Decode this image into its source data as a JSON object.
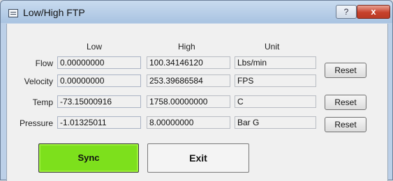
{
  "window": {
    "title": "Low/High FTP",
    "help_glyph": "?",
    "close_glyph": "x"
  },
  "columns": {
    "low": "Low",
    "high": "High",
    "unit": "Unit"
  },
  "rows": [
    {
      "label": "Flow",
      "low": "0.00000000",
      "high": "100.34146120",
      "unit": "Lbs/min"
    },
    {
      "label": "Velocity",
      "low": "0.00000000",
      "high": "253.39686584",
      "unit": "FPS"
    },
    {
      "label": "Temp",
      "low": "-73.15000916",
      "high": "1758.00000000",
      "unit": "C"
    },
    {
      "label": "Pressure",
      "low": "-1.01325011",
      "high": "8.00000000",
      "unit": "Bar G"
    }
  ],
  "buttons": {
    "reset_1": "Reset",
    "reset_2": "Reset",
    "reset_3": "Reset",
    "sync": "Sync",
    "exit": "Exit"
  },
  "colors": {
    "sync_button": "#7de01c",
    "close_button": "#c7412c",
    "title_bar": "#bcd0e8"
  },
  "icons": [
    "app-window-icon",
    "help-icon",
    "close-icon"
  ]
}
